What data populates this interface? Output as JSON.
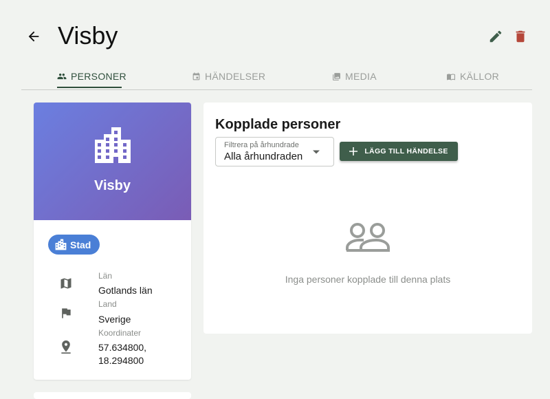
{
  "header": {
    "back_icon": "arrow-back-icon",
    "title": "Visby",
    "edit_icon": "pencil-icon",
    "delete_icon": "trash-icon",
    "edit_color": "#3f5e4b",
    "delete_color": "#b5473a"
  },
  "tabs": [
    {
      "label": "PERSONER",
      "icon": "people-icon",
      "active": true
    },
    {
      "label": "HÄNDELSER",
      "icon": "calendar-icon",
      "active": false
    },
    {
      "label": "MEDIA",
      "icon": "images-icon",
      "active": false
    },
    {
      "label": "KÄLLOR",
      "icon": "book-icon",
      "active": false
    }
  ],
  "place": {
    "banner_icon": "city-icon",
    "name": "Visby",
    "type_chip": {
      "icon": "city-icon",
      "label": "Stad"
    },
    "fields": [
      {
        "icon": "map-icon",
        "label": "Län",
        "value": "Gotlands län"
      },
      {
        "icon": "flag-icon",
        "label": "Land",
        "value": "Sverige"
      },
      {
        "icon": "location-pin-icon",
        "label": "Koordinater",
        "value": "57.634800, 18.294800"
      }
    ]
  },
  "persons_panel": {
    "title": "Kopplade personer",
    "filter": {
      "label": "Filtrera på århundrade",
      "value": "Alla århundraden"
    },
    "add_button": {
      "icon": "plus-icon",
      "label": "LÄGG TILL HÄNDELSE"
    },
    "empty_icon": "people-outline-icon",
    "empty_text": "Inga personer kopplade till denna plats"
  },
  "colors": {
    "accent": "#3f5e4b",
    "chip": "#4a7fd6",
    "banner_start": "#6b7fe0",
    "banner_end": "#7a5cb5"
  }
}
